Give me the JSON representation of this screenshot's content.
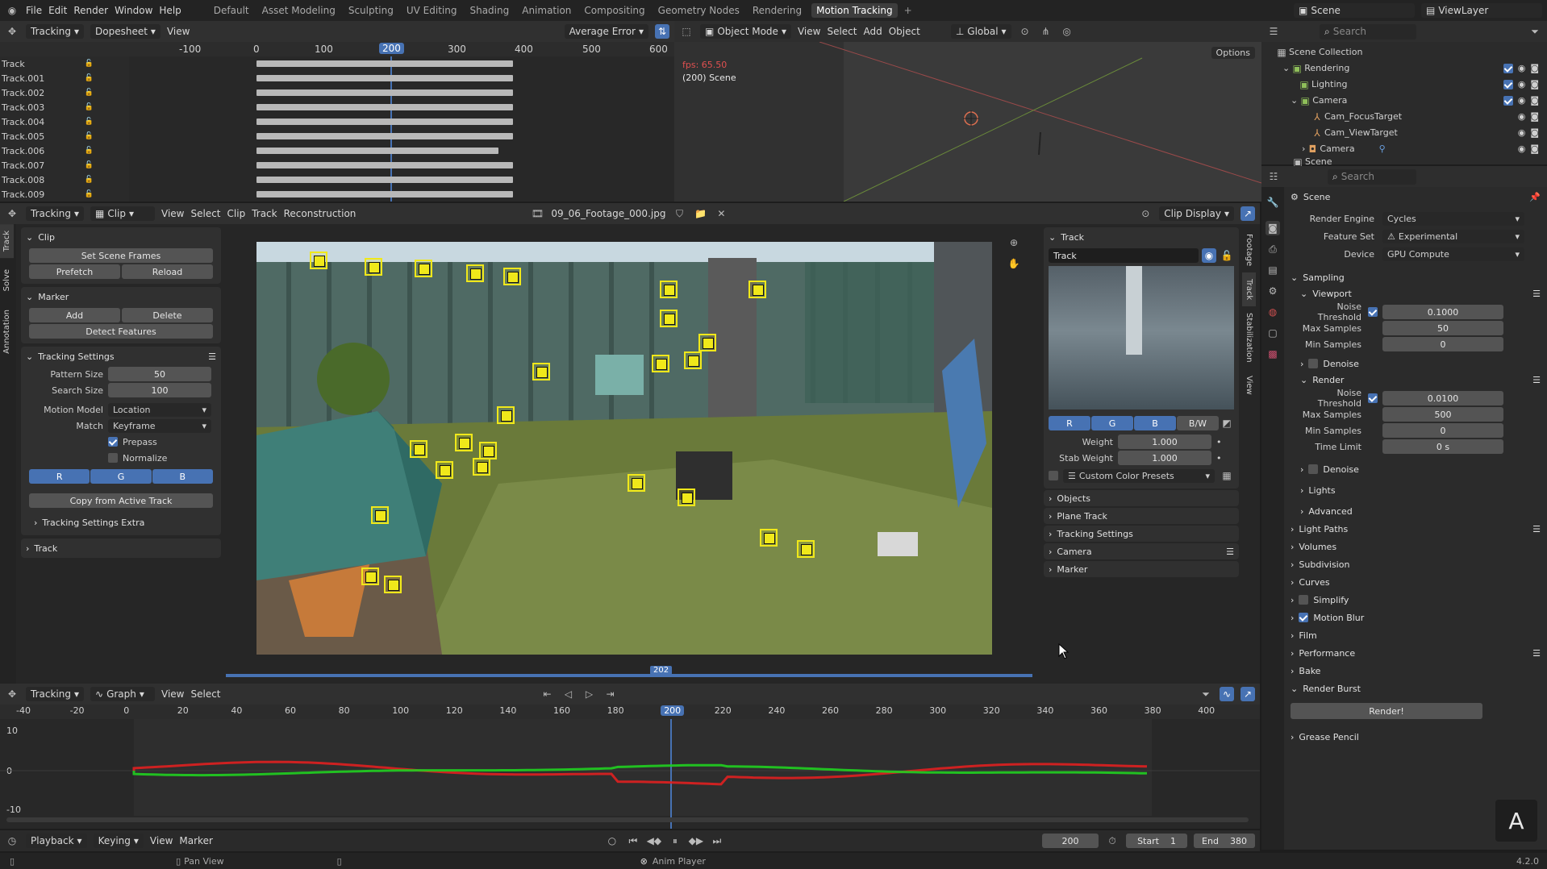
{
  "topbar": {
    "menus": [
      "File",
      "Edit",
      "Render",
      "Window",
      "Help"
    ],
    "workspaces": [
      "Default",
      "Asset Modeling",
      "Sculpting",
      "UV Editing",
      "Shading",
      "Animation",
      "Compositing",
      "Geometry Nodes",
      "Rendering",
      "Motion Tracking"
    ],
    "active_workspace": "Motion Tracking",
    "scene": "Scene",
    "viewlayer": "ViewLayer"
  },
  "dopesheet": {
    "editor": "Tracking",
    "mode": "Dopesheet",
    "view": "View",
    "sort": "Average Error",
    "ruler": [
      "-100",
      "0",
      "100",
      "200",
      "300",
      "400",
      "500",
      "600"
    ],
    "current": "200",
    "tracks": [
      "Track",
      "Track.001",
      "Track.002",
      "Track.003",
      "Track.004",
      "Track.005",
      "Track.006",
      "Track.007",
      "Track.008",
      "Track.009"
    ]
  },
  "viewport": {
    "mode": "Object Mode",
    "menus": [
      "View",
      "Select",
      "Add",
      "Object"
    ],
    "orientation": "Global",
    "options": "Options",
    "fps": "fps: 65.50",
    "scene_label": "(200) Scene"
  },
  "outliner": {
    "search": "Search",
    "root": "Scene Collection",
    "items": [
      {
        "name": "Rendering"
      },
      {
        "name": "Lighting"
      },
      {
        "name": "Camera"
      },
      {
        "name": "Cam_FocusTarget"
      },
      {
        "name": "Cam_ViewTarget"
      },
      {
        "name": "Camera"
      },
      {
        "name": "Scene"
      }
    ]
  },
  "clip_editor": {
    "editor": "Tracking",
    "mode": "Clip",
    "menus": [
      "View",
      "Select",
      "Clip",
      "Track",
      "Reconstruction"
    ],
    "file": "09_06_Footage_000.jpg",
    "display": "Clip Display",
    "frame_badge": "202"
  },
  "toolshelf": {
    "tabs": [
      "Track",
      "Solve",
      "Annotation"
    ],
    "clip": {
      "title": "Clip",
      "set_scene_frames": "Set Scene Frames",
      "prefetch": "Prefetch",
      "reload": "Reload"
    },
    "marker": {
      "title": "Marker",
      "add": "Add",
      "delete": "Delete",
      "detect": "Detect Features"
    },
    "tracking": {
      "title": "Tracking Settings",
      "pattern_label": "Pattern Size",
      "pattern": "50",
      "search_label": "Search Size",
      "search": "100",
      "motion_label": "Motion Model",
      "motion": "Location",
      "match_label": "Match",
      "match": "Keyframe",
      "prepass": "Prepass",
      "normalize": "Normalize",
      "r": "R",
      "g": "G",
      "b": "B",
      "copy": "Copy from Active Track",
      "extra": "Tracking Settings Extra",
      "track": "Track"
    }
  },
  "track_panel": {
    "title": "Track",
    "name": "Track",
    "r": "R",
    "g": "G",
    "b": "B",
    "bw": "B/W",
    "weight_label": "Weight",
    "weight": "1.000",
    "stab_label": "Stab Weight",
    "stab": "1.000",
    "presets": "Custom Color Presets",
    "sections": [
      "Objects",
      "Plane Track",
      "Tracking Settings",
      "Camera",
      "Marker"
    ],
    "vtabs": [
      "Footage",
      "Track",
      "Stabilization",
      "View"
    ]
  },
  "graph": {
    "editor": "Tracking",
    "mode": "Graph",
    "menus": [
      "View",
      "Select"
    ],
    "ruler": [
      "-40",
      "-20",
      "0",
      "20",
      "40",
      "60",
      "80",
      "100",
      "120",
      "140",
      "160",
      "180",
      "200",
      "220",
      "240",
      "260",
      "280",
      "300",
      "320",
      "340",
      "360",
      "380",
      "400"
    ],
    "current": "200",
    "y_ticks": [
      "10",
      "0",
      "-10"
    ]
  },
  "timeline": {
    "menus": [
      "Playback",
      "Keying",
      "View",
      "Marker"
    ],
    "frame": "200",
    "start_label": "Start",
    "start": "1",
    "end_label": "End",
    "end": "380"
  },
  "statusbar": {
    "left": "Pan View",
    "center": "Anim Player",
    "version": "4.2.0"
  },
  "properties": {
    "search": "Search",
    "scene": "Scene",
    "engine_label": "Render Engine",
    "engine": "Cycles",
    "feature_label": "Feature Set",
    "feature": "Experimental",
    "device_label": "Device",
    "device": "GPU Compute",
    "sampling": "Sampling",
    "viewport": "Viewport",
    "vp_noise_label": "Noise Threshold",
    "vp_noise": "0.1000",
    "vp_max_label": "Max Samples",
    "vp_max": "50",
    "vp_min_label": "Min Samples",
    "vp_min": "0",
    "denoise": "Denoise",
    "render": "Render",
    "r_noise_label": "Noise Threshold",
    "r_noise": "0.0100",
    "r_max_label": "Max Samples",
    "r_max": "500",
    "r_min_label": "Min Samples",
    "r_min": "0",
    "r_time_label": "Time Limit",
    "r_time": "0 s",
    "denoise2": "Denoise",
    "lights": "Lights",
    "advanced": "Advanced",
    "sections": [
      "Light Paths",
      "Volumes",
      "Subdivision",
      "Curves",
      "Simplify",
      "Motion Blur",
      "Film",
      "Performance",
      "Bake",
      "Render Burst"
    ],
    "render_button": "Render!",
    "grease": "Grease Pencil"
  }
}
